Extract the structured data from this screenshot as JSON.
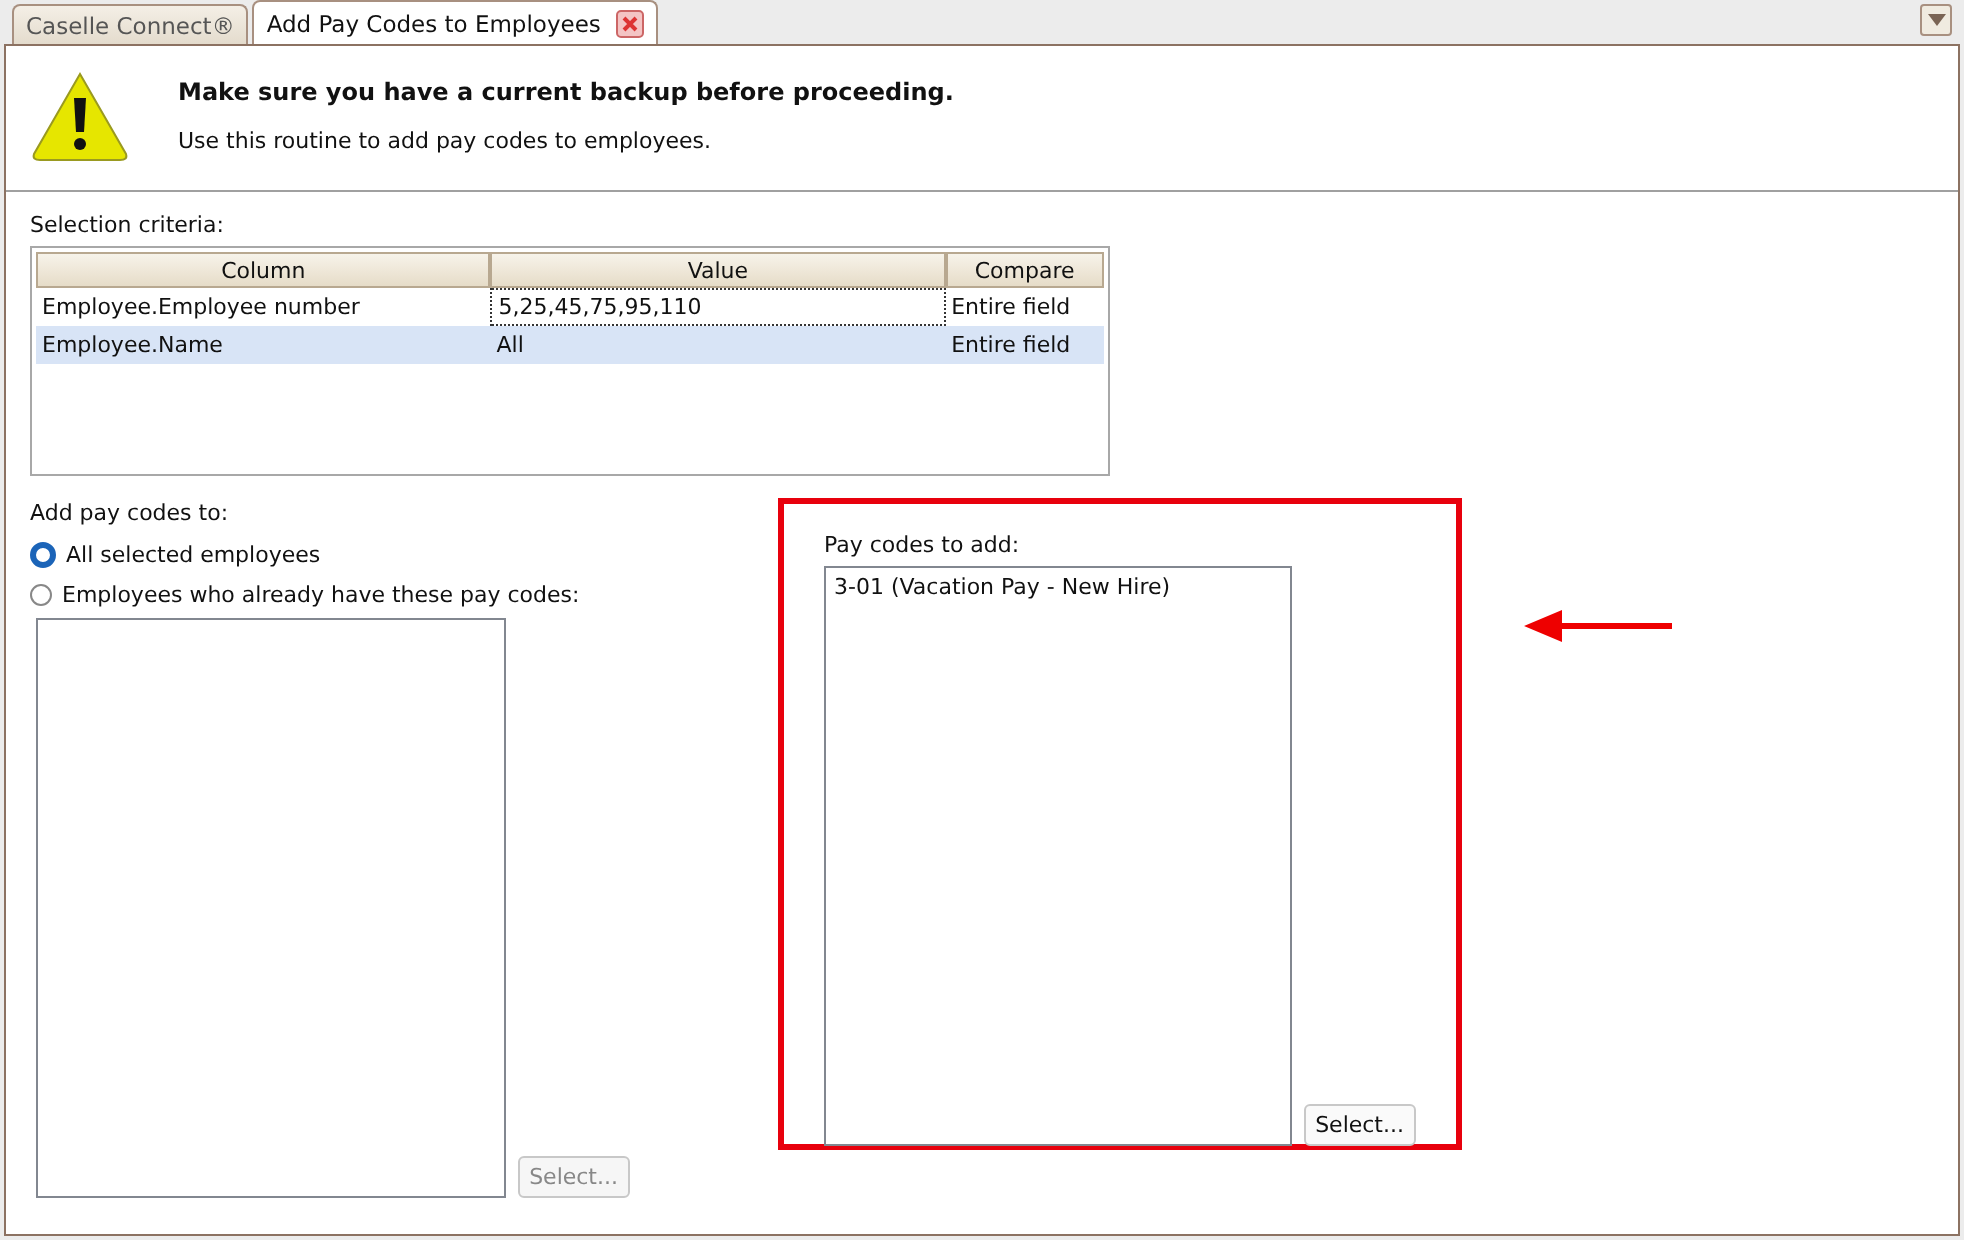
{
  "tabs": [
    {
      "label": "Caselle Connect®",
      "selected": false,
      "closable": false
    },
    {
      "label": "Add Pay Codes to Employees",
      "selected": true,
      "closable": true
    }
  ],
  "header": {
    "title": "Make sure you have a current backup before proceeding.",
    "subtitle": "Use this routine to add pay codes to employees."
  },
  "criteria": {
    "label": "Selection criteria:",
    "columns": [
      "Column",
      "Value",
      "Compare"
    ],
    "rows": [
      {
        "cells": [
          "Employee.Employee number",
          "5,25,45,75,95,110",
          "Entire field"
        ],
        "selected": false,
        "focused": true
      },
      {
        "cells": [
          "Employee.Name",
          "All",
          "Entire field"
        ],
        "selected": true,
        "focused": false
      }
    ]
  },
  "add_to": {
    "label": "Add pay codes to:",
    "options": [
      {
        "label": "All selected employees",
        "selected": true
      },
      {
        "label": "Employees who already have these pay codes:",
        "selected": false
      }
    ],
    "button": {
      "label": "Select...",
      "disabled": true
    }
  },
  "pay_codes": {
    "label": "Pay codes to add:",
    "items": [
      "3-01 (Vacation Pay - New Hire)"
    ],
    "button": {
      "label": "Select...",
      "disabled": false
    }
  }
}
